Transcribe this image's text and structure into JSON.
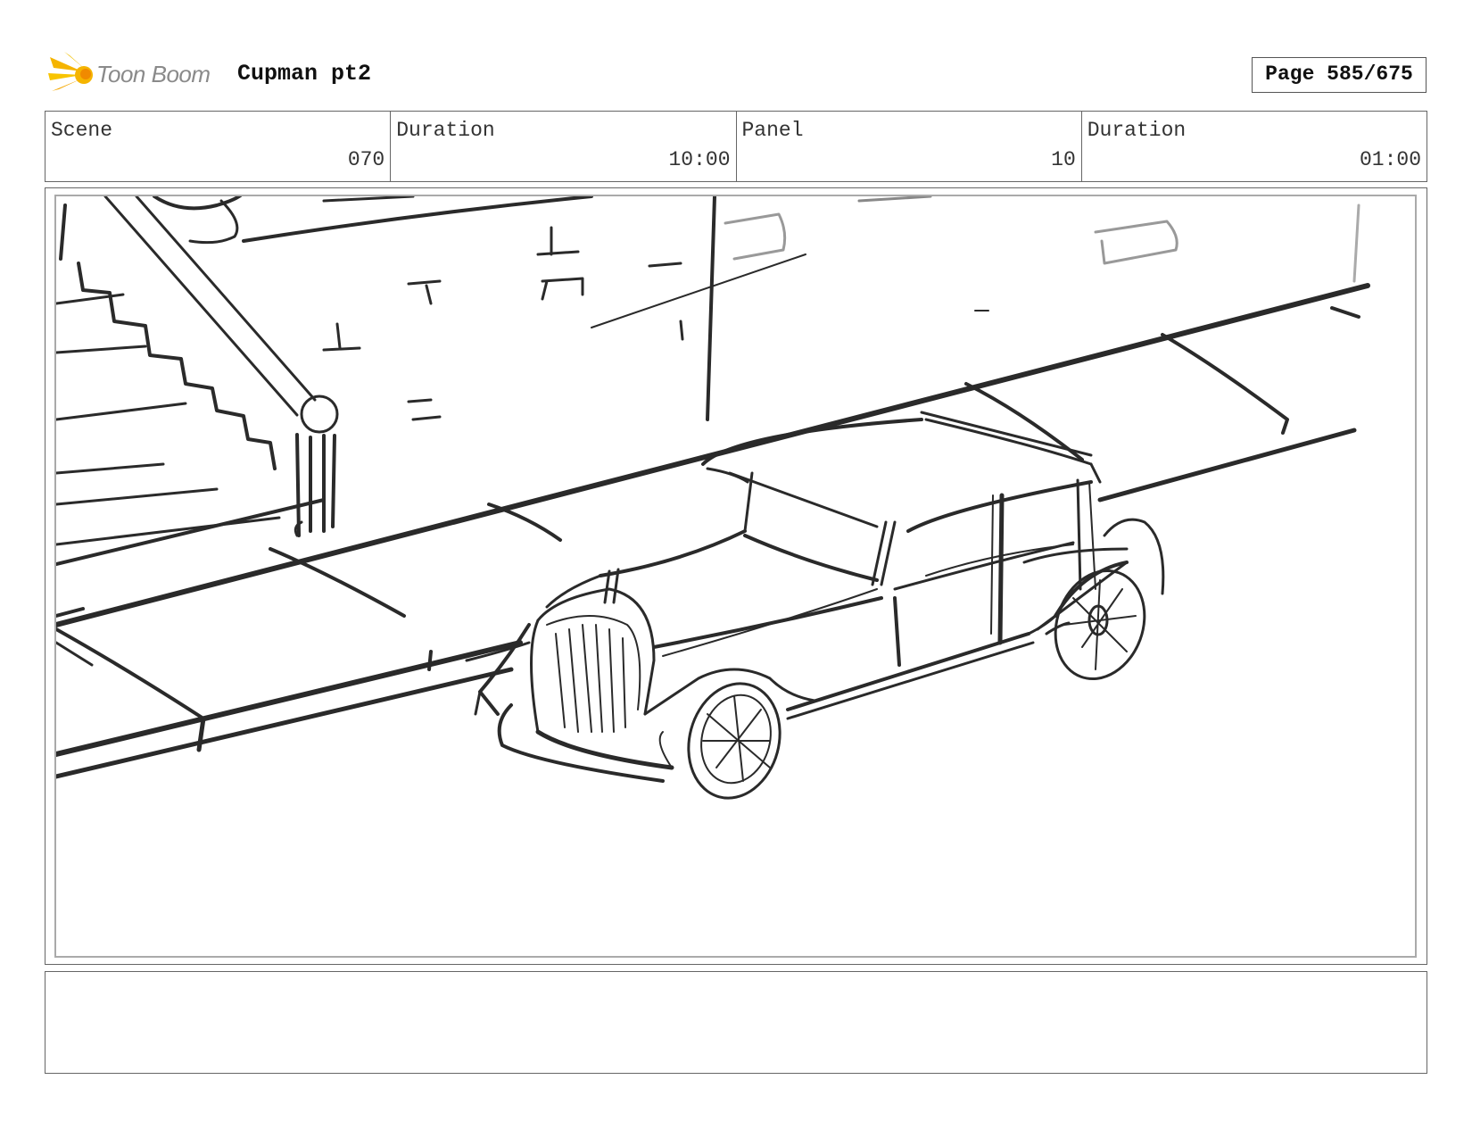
{
  "header": {
    "logo_text": "Toon Boom",
    "project_title": "Cupman pt2",
    "page_label": "Page 585/675"
  },
  "info": {
    "scene": {
      "label": "Scene",
      "value": "070"
    },
    "scene_duration": {
      "label": "Duration",
      "value": "10:00"
    },
    "panel": {
      "label": "Panel",
      "value": "10"
    },
    "panel_duration": {
      "label": "Duration",
      "value": "01:00"
    }
  },
  "panel": {
    "image": "storyboard-sketch-vintage-car-by-curb-with-stairs"
  },
  "notes": {
    "text": ""
  },
  "colors": {
    "logo_yellow": "#f5b400",
    "logo_orange": "#f08a00",
    "sketch_stroke": "#2a2a2a",
    "sketch_light": "#9a9a9a"
  }
}
